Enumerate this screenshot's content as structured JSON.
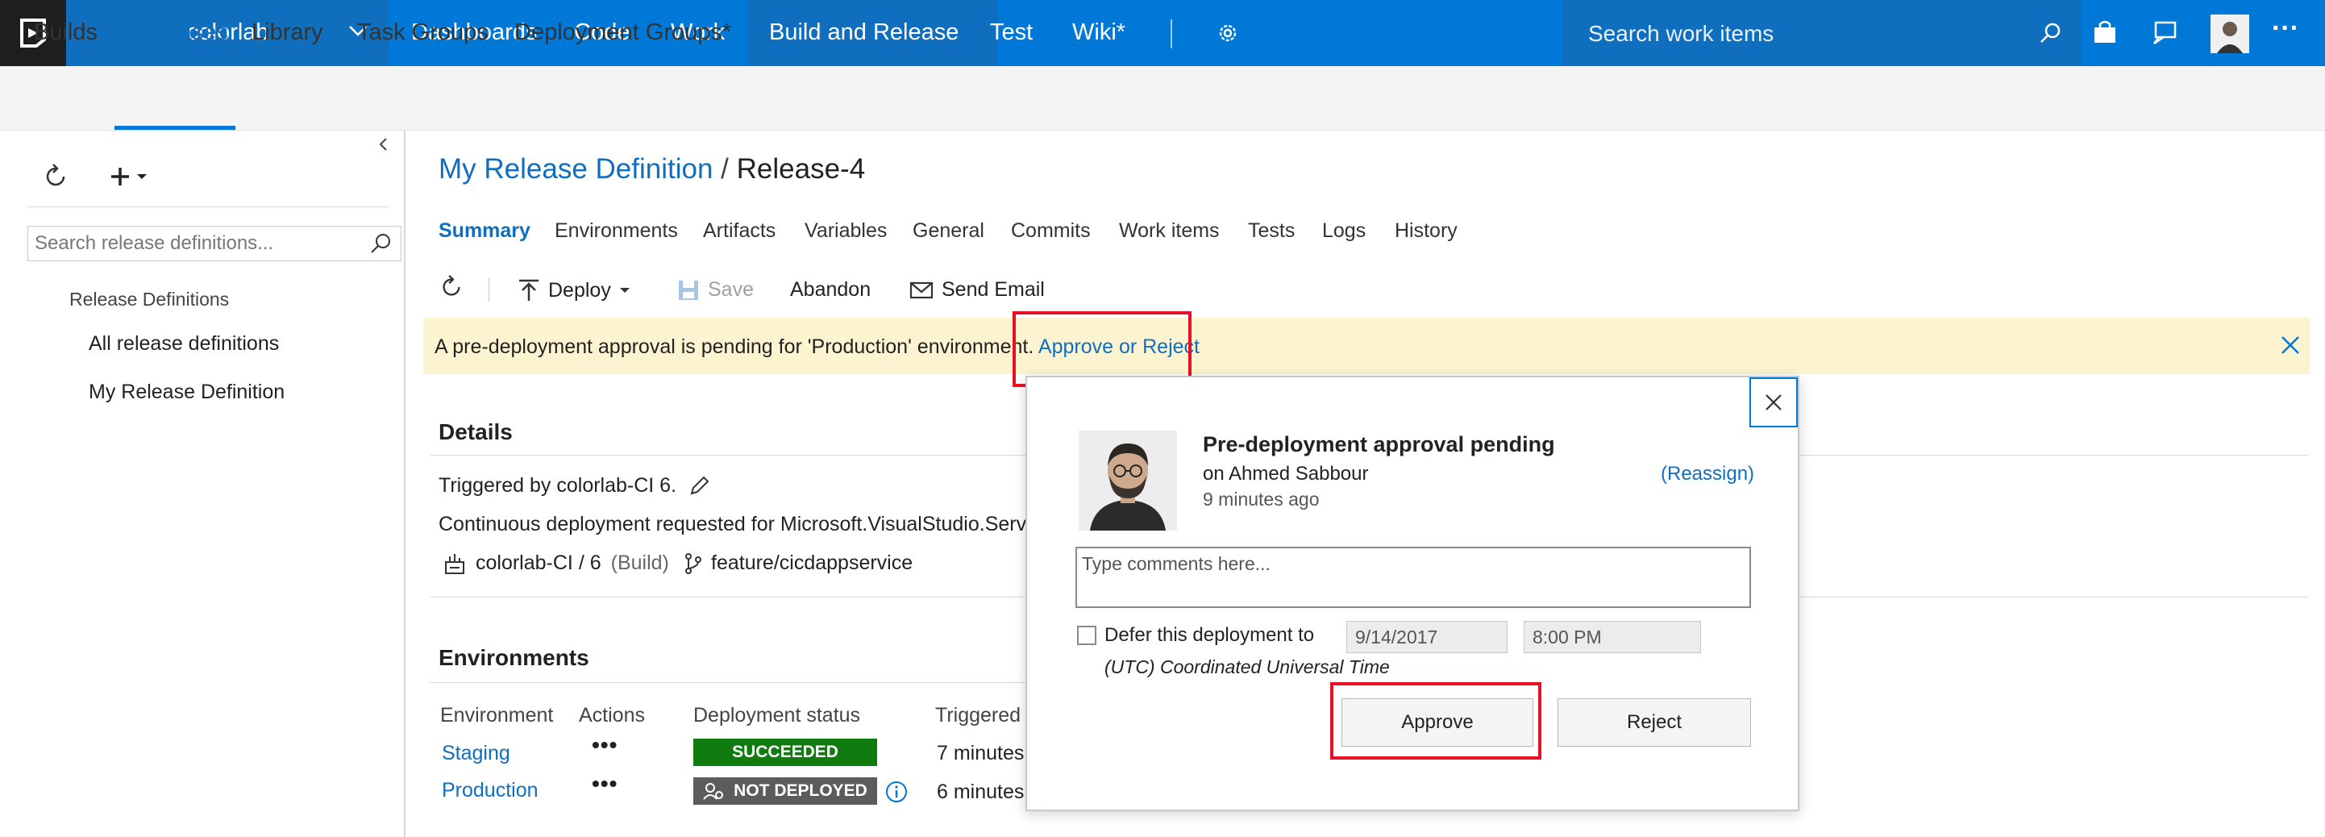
{
  "topbar": {
    "project": "colorlab",
    "nav": [
      "Dashboards",
      "Code",
      "Work",
      "Build and Release",
      "Test",
      "Wiki*"
    ],
    "search_placeholder": "Search work items"
  },
  "subnav": {
    "items": [
      "Builds",
      "Releases",
      "Library",
      "Task Groups",
      "Deployment Groups*"
    ]
  },
  "left_panel": {
    "search_placeholder": "Search release definitions...",
    "section": "Release Definitions",
    "items": [
      "All release definitions",
      "My Release Definition"
    ]
  },
  "main": {
    "breadcrumb_definition": "My Release Definition",
    "breadcrumb_sep": "/",
    "breadcrumb_release": "Release-4",
    "tabs": [
      "Summary",
      "Environments",
      "Artifacts",
      "Variables",
      "General",
      "Commits",
      "Work items",
      "Tests",
      "Logs",
      "History"
    ],
    "toolbar": {
      "deploy": "Deploy",
      "save": "Save",
      "abandon": "Abandon",
      "send_email": "Send Email"
    },
    "banner": {
      "text": "A pre-deployment approval is pending for 'Production' environment.",
      "link": "Approve or Reject"
    },
    "details": {
      "title": "Details",
      "triggered": "Triggered by colorlab-CI 6.",
      "continuous": "Continuous deployment requested for Microsoft.VisualStudio.Service",
      "build_name": "colorlab-CI / 6",
      "build_type": "(Build)",
      "branch": "feature/cicdappservice"
    },
    "environments": {
      "title": "Environments",
      "headers": [
        "Environment",
        "Actions",
        "Deployment status",
        "Triggered"
      ],
      "rows": [
        {
          "name": "Staging",
          "actions": "•••",
          "status": "SUCCEEDED",
          "status_color": "#107c10",
          "triggered": "7 minutes"
        },
        {
          "name": "Production",
          "actions": "•••",
          "status": "NOT DEPLOYED",
          "status_color": "#5c5c5c",
          "triggered": "6 minutes"
        }
      ]
    }
  },
  "modal": {
    "title": "Pre-deployment approval pending",
    "approver": "on Ahmed Sabbour",
    "time": "9 minutes ago",
    "reassign": "(Reassign)",
    "comments_placeholder": "Type comments here...",
    "defer_label": "Defer this deployment to",
    "defer_date": "9/14/2017",
    "defer_time": "8:00 PM",
    "timezone": "(UTC) Coordinated Universal Time",
    "approve": "Approve",
    "reject": "Reject"
  },
  "colors": {
    "accent": "#0078d7",
    "link": "#106ebe",
    "highlight": "#e81123",
    "banner": "#fcf4d0"
  }
}
